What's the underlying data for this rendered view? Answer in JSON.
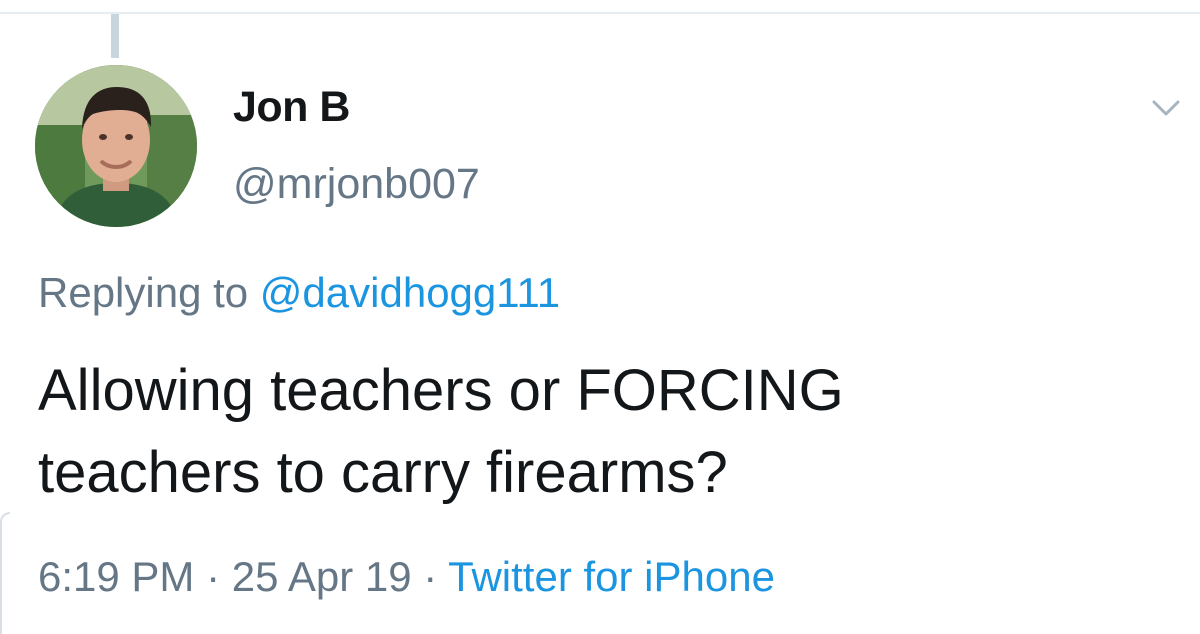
{
  "tweet": {
    "author": {
      "display_name": "Jon B",
      "handle": "@mrjonb007",
      "avatar": "avatar-photo"
    },
    "reply": {
      "prefix": "Replying to ",
      "mention": "@davidhogg111"
    },
    "text_line1": "Allowing teachers or FORCING",
    "text_line2": "teachers to carry firearms?",
    "meta": {
      "time": "6:19 PM",
      "separator": " · ",
      "date": "25 Apr 19",
      "source": "Twitter for iPhone"
    },
    "menu_icon": "chevron-down-icon"
  },
  "colors": {
    "text": "#14171a",
    "secondary": "#657786",
    "link": "#1b95e0",
    "thread_line": "#c9d5dd"
  }
}
